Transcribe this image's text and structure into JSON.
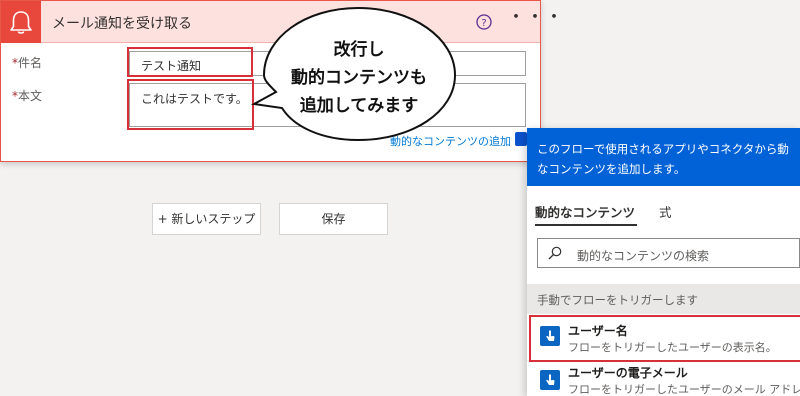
{
  "action_card": {
    "title": "メール通知を受け取る",
    "icon": "bell-icon",
    "help_icon": "help-icon",
    "more_label": "・・・",
    "fields": {
      "subject": {
        "required_mark": "*",
        "label": "件名",
        "value": "テスト通知"
      },
      "body": {
        "required_mark": "*",
        "label": "本文",
        "value": "これはテストです。"
      }
    },
    "dynamic_content_link": "動的なコンテンツの追加"
  },
  "callout": {
    "lines": [
      "改行し",
      "動的コンテンツも",
      "追加してみます"
    ]
  },
  "buttons": {
    "new_step": "+ 新しいステップ",
    "save": "保存"
  },
  "dynamic_panel": {
    "header_lines": [
      "このフローで使用されるアプリやコネクタから動",
      "なコンテンツを追加します。"
    ],
    "tabs": {
      "dynamic": "動的なコンテンツ",
      "expression": "式"
    },
    "search": {
      "placeholder": "動的なコンテンツの検索"
    },
    "section": "手動でフローをトリガーします",
    "items": [
      {
        "name": "ユーザー名",
        "description": "フローをトリガーしたユーザーの表示名。",
        "icon": "touch-hand-icon"
      },
      {
        "name": "ユーザーの電子メール",
        "description": "フローをトリガーしたユーザーのメール アドレ",
        "icon": "touch-hand-icon"
      }
    ]
  },
  "colors": {
    "accent_red": "#e8473b",
    "header_pink": "#fde1de",
    "highlight_red": "#d7303a",
    "panel_blue": "#0062d6",
    "link_blue": "#0078d4"
  }
}
